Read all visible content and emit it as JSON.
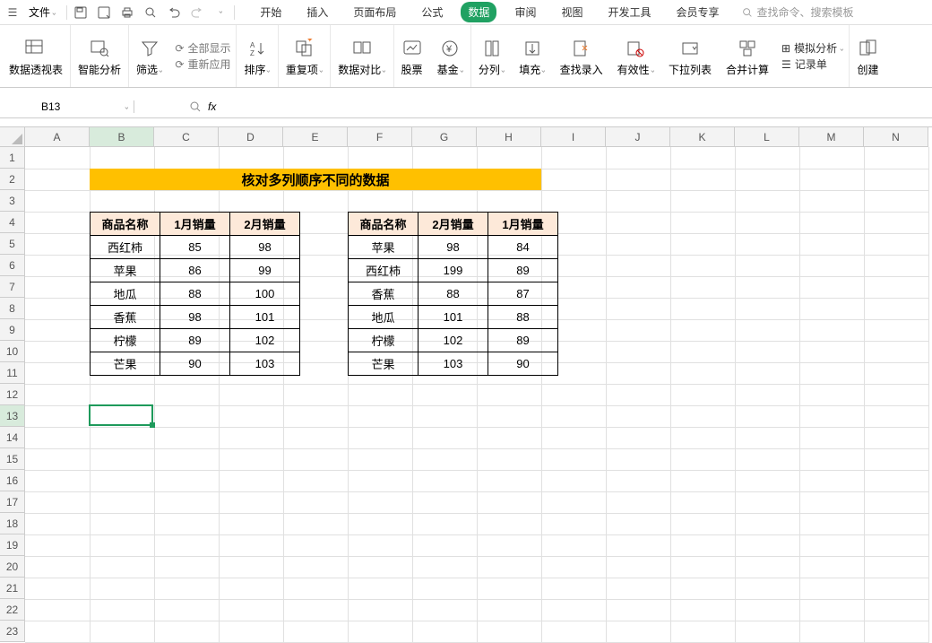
{
  "menubar": {
    "file": "文件",
    "tabs": [
      "开始",
      "插入",
      "页面布局",
      "公式",
      "数据",
      "审阅",
      "视图",
      "开发工具",
      "会员专享"
    ],
    "active_tab_index": 4,
    "search_placeholder": "查找命令、搜索模板"
  },
  "ribbon": {
    "items": [
      {
        "label": "数据透视表"
      },
      {
        "label": "智能分析"
      },
      {
        "label": "筛选"
      },
      {
        "label": "排序"
      },
      {
        "label": "重复项"
      },
      {
        "label": "数据对比"
      },
      {
        "label": "股票"
      },
      {
        "label": "基金"
      },
      {
        "label": "分列"
      },
      {
        "label": "填充"
      },
      {
        "label": "查找录入"
      },
      {
        "label": "有效性"
      },
      {
        "label": "下拉列表"
      },
      {
        "label": "合并计算"
      },
      {
        "label": "创建"
      }
    ],
    "filter_stack": [
      "全部显示",
      "重新应用"
    ],
    "right_stack": [
      "模拟分析",
      "记录单"
    ]
  },
  "namebox": {
    "value": "B13",
    "fx": "fx"
  },
  "columns": [
    "A",
    "B",
    "C",
    "D",
    "E",
    "F",
    "G",
    "H",
    "I",
    "J",
    "K",
    "L",
    "M",
    "N"
  ],
  "rows": [
    "1",
    "2",
    "3",
    "4",
    "5",
    "6",
    "7",
    "8",
    "9",
    "10",
    "11",
    "12",
    "13",
    "14",
    "15",
    "16",
    "17",
    "18",
    "19",
    "20",
    "21",
    "22",
    "23"
  ],
  "title_text": "核对多列顺序不同的数据",
  "selected_col_index": 1,
  "selected_row_index": 12,
  "table_left": {
    "headers": [
      "商品名称",
      "1月销量",
      "2月销量"
    ],
    "rows": [
      [
        "西红柿",
        "85",
        "98"
      ],
      [
        "苹果",
        "86",
        "99"
      ],
      [
        "地瓜",
        "88",
        "100"
      ],
      [
        "香蕉",
        "98",
        "101"
      ],
      [
        "柠檬",
        "89",
        "102"
      ],
      [
        "芒果",
        "90",
        "103"
      ]
    ]
  },
  "table_right": {
    "headers": [
      "商品名称",
      "2月销量",
      "1月销量"
    ],
    "rows": [
      [
        "苹果",
        "98",
        "84"
      ],
      [
        "西红柿",
        "199",
        "89"
      ],
      [
        "香蕉",
        "88",
        "87"
      ],
      [
        "地瓜",
        "101",
        "88"
      ],
      [
        "柠檬",
        "102",
        "89"
      ],
      [
        "芒果",
        "103",
        "90"
      ]
    ]
  },
  "colors": {
    "accent": "#20a162",
    "title_band": "#FFC000",
    "header_fill": "#FDE9D9"
  }
}
